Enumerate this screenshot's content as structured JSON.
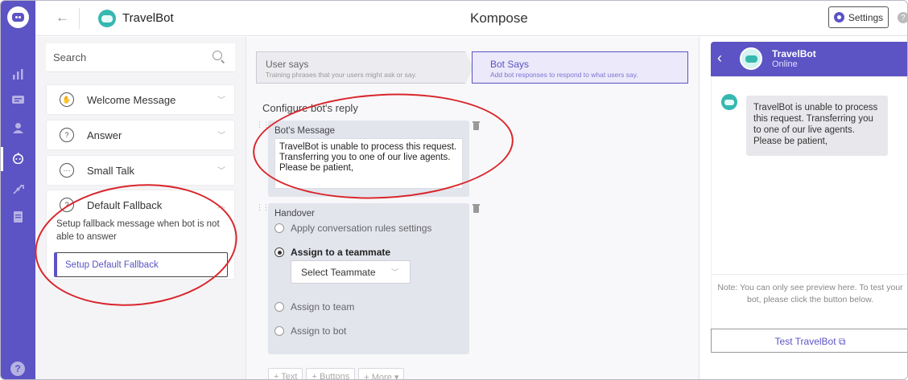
{
  "app": {
    "bot_name": "TravelBot",
    "page_title": "Kompose",
    "settings_label": "Settings",
    "help_glyph": "?"
  },
  "rail": {
    "items": [
      "logo-icon",
      "analytics-icon",
      "conversations-icon",
      "users-icon",
      "bot-icon",
      "integrations-icon",
      "docs-icon",
      "help-icon"
    ],
    "active": "bot-icon",
    "accent": "#5c53c4"
  },
  "intents": {
    "search_placeholder": "Search",
    "items": [
      {
        "label": "Welcome Message",
        "icon": "wave-hand-icon"
      },
      {
        "label": "Answer",
        "icon": "answer-icon"
      },
      {
        "label": "Small Talk",
        "icon": "small-talk-icon"
      }
    ],
    "fallback": {
      "label": "Default Fallback",
      "icon": "fallback-icon",
      "description": "Setup fallback message when bot is not able to answer",
      "button": "Setup Default Fallback"
    }
  },
  "builder": {
    "steps": [
      {
        "title": "User says",
        "subtitle": "Training phrases that your users might ask or say."
      },
      {
        "title": "Bot Says",
        "subtitle": "Add bot responses to respond to what users say."
      }
    ],
    "configure_label": "Configure bot's reply",
    "message_card": {
      "title": "Bot's Message",
      "text": "TravelBot is unable to process this request. Transferring you to one of our live agents. Please be patient,"
    },
    "handover_card": {
      "title": "Handover",
      "options": [
        {
          "label": "Apply conversation rules settings",
          "selected": false
        },
        {
          "label": "Assign to a teammate",
          "selected": true
        },
        {
          "label": "Assign to team",
          "selected": false
        },
        {
          "label": "Assign to bot",
          "selected": false
        }
      ],
      "select_placeholder": "Select Teammate"
    },
    "add_buttons": [
      "+ Text",
      "+ Buttons",
      "+ More ▾"
    ]
  },
  "preview": {
    "bot_name": "TravelBot",
    "status": "Online",
    "message": "TravelBot is unable to process this request. Transferring you to one of our live agents. Please be patient,",
    "note": "Note: You can only see preview here. To test your bot, please click the button below.",
    "test_button": "Test TravelBot ⧉"
  },
  "annotations": {
    "ellipse_color": "#d9262c",
    "count": 2
  }
}
